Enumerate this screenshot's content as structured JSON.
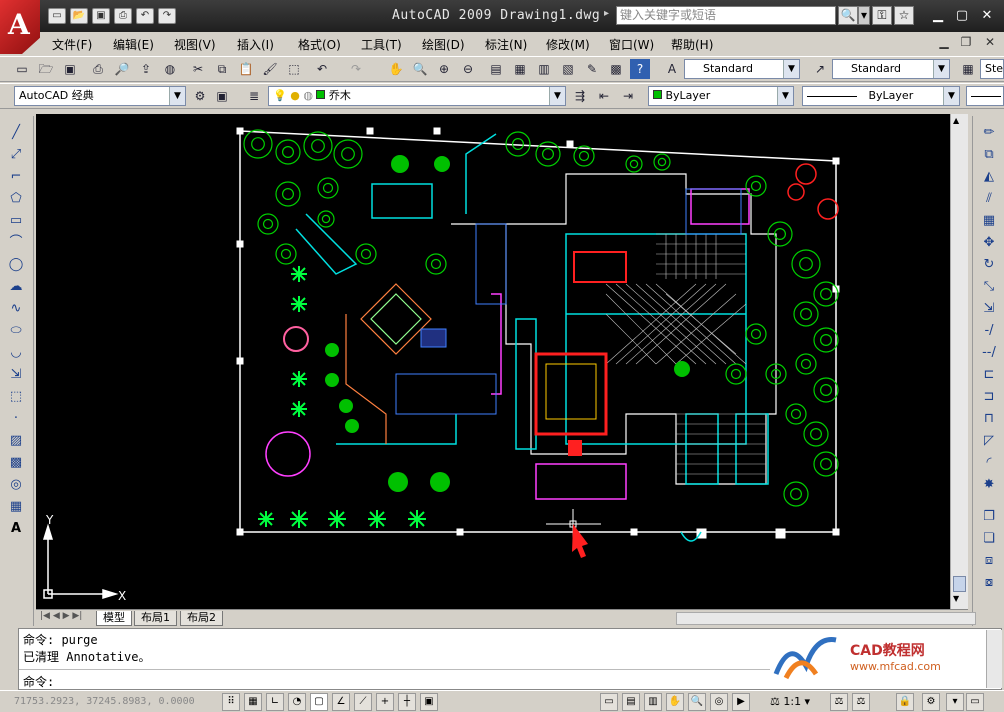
{
  "app": {
    "logo_letter": "A",
    "window_title": "AutoCAD 2009 Drawing1.dwg",
    "search_placeholder": "键入关键字或短语"
  },
  "menu": [
    "文件(F)",
    "编辑(E)",
    "视图(V)",
    "插入(I)",
    "格式(O)",
    "工具(T)",
    "绘图(D)",
    "标注(N)",
    "修改(M)",
    "窗口(W)",
    "帮助(H)"
  ],
  "toolbar": {
    "text_style": "Standard",
    "dim_style": "Standard",
    "table_style_partial": "Ste",
    "workspace": "AutoCAD 经典",
    "layer": "乔木",
    "color": "ByLayer",
    "linetype": "ByLayer"
  },
  "drawing": {
    "ucs_y": "Y",
    "ucs_x": "X"
  },
  "tabs": [
    "模型",
    "布局1",
    "布局2"
  ],
  "command": {
    "line1": "命令: purge",
    "line2": "已清理 Annotative。",
    "prompt": "命令:"
  },
  "brand": {
    "name": "CAD教程网",
    "url": "www.mfcad.com"
  },
  "status": {
    "coords": "71753.2923, 37245.8983, 0.0000",
    "scale": "1:1"
  },
  "colors": {
    "accent_green": "#00c000",
    "cyan": "#00e0e0",
    "magenta": "#ff40ff",
    "title_bar": "#2a2a2a"
  }
}
